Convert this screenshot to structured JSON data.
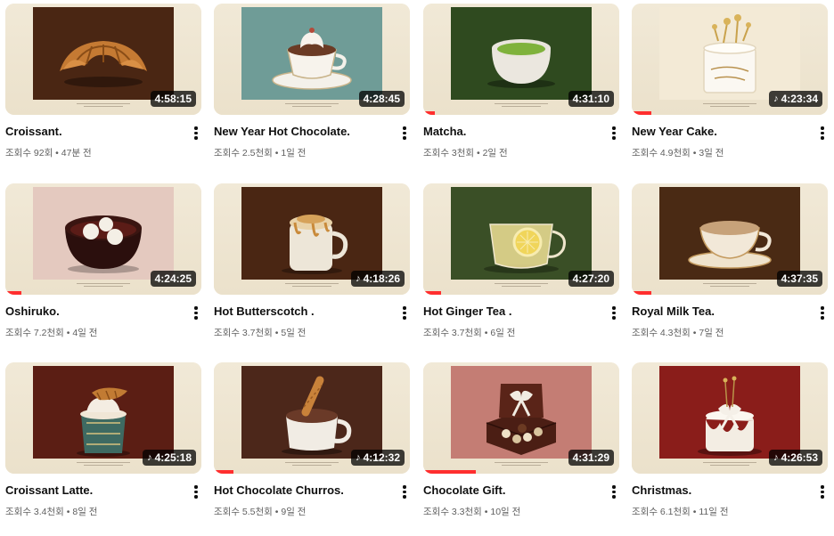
{
  "videos": [
    {
      "title": "Croissant.",
      "views": "조회수 92회",
      "age": "47분 전",
      "duration": "4:58:15",
      "music": false,
      "progress": 0.0,
      "bg": "#4a2613",
      "item": "croissant-icon"
    },
    {
      "title": "New Year Hot Chocolate.",
      "views": "조회수 2.5천회",
      "age": "1일 전",
      "duration": "4:28:45",
      "music": false,
      "progress": 0.0,
      "bg": "#6f9c97",
      "item": "cocoa-cup-icon"
    },
    {
      "title": "Matcha.",
      "views": "조회수 3천회",
      "age": "2일 전",
      "duration": "4:31:10",
      "music": false,
      "progress": 0.06,
      "bg": "#2f4a1f",
      "item": "matcha-bowl-icon"
    },
    {
      "title": "New Year Cake.",
      "views": "조회수 4.9천회",
      "age": "3일 전",
      "duration": "4:23:34",
      "music": true,
      "progress": 0.1,
      "bg": "#f3ead6",
      "item": "cake-icon"
    },
    {
      "title": "Oshiruko.",
      "views": "조회수 7.2천회",
      "age": "4일 전",
      "duration": "4:24:25",
      "music": false,
      "progress": 0.08,
      "bg": "#e4c9bf",
      "item": "oshiruko-bowl-icon"
    },
    {
      "title": "Hot Butterscotch .",
      "views": "조회수 3.7천회",
      "age": "5일 전",
      "duration": "4:18:26",
      "music": true,
      "progress": 0.0,
      "bg": "#4a2613",
      "item": "butterscotch-mug-icon"
    },
    {
      "title": "Hot Ginger Tea .",
      "views": "조회수 3.7천회",
      "age": "6일 전",
      "duration": "4:27:20",
      "music": false,
      "progress": 0.09,
      "bg": "#3a4f26",
      "item": "ginger-tea-icon"
    },
    {
      "title": "Royal Milk Tea.",
      "views": "조회수 4.3천회",
      "age": "7일 전",
      "duration": "4:37:35",
      "music": false,
      "progress": 0.1,
      "bg": "#4a2a14",
      "item": "milk-tea-cup-icon"
    },
    {
      "title": "Croissant Latte.",
      "views": "조회수 3.4천회",
      "age": "8일 전",
      "duration": "4:25:18",
      "music": true,
      "progress": 0.0,
      "bg": "#5b1e14",
      "item": "latte-cup-icon"
    },
    {
      "title": "Hot Chocolate Churros.",
      "views": "조회수 5.5천회",
      "age": "9일 전",
      "duration": "4:12:32",
      "music": true,
      "progress": 0.1,
      "bg": "#4c271a",
      "item": "churros-mug-icon"
    },
    {
      "title": "Chocolate Gift.",
      "views": "조회수 3.3천회",
      "age": "10일 전",
      "duration": "4:31:29",
      "music": false,
      "progress": 0.27,
      "bg": "#c47d74",
      "item": "gift-box-icon"
    },
    {
      "title": "Christmas.",
      "views": "조회수 6.1천회",
      "age": "11일 전",
      "duration": "4:26:53",
      "music": true,
      "progress": 0.0,
      "bg": "#8a1d1a",
      "item": "christmas-cake-icon"
    }
  ],
  "labels": {
    "separator": "•",
    "music_note": "♪",
    "more": "more-options-icon"
  }
}
